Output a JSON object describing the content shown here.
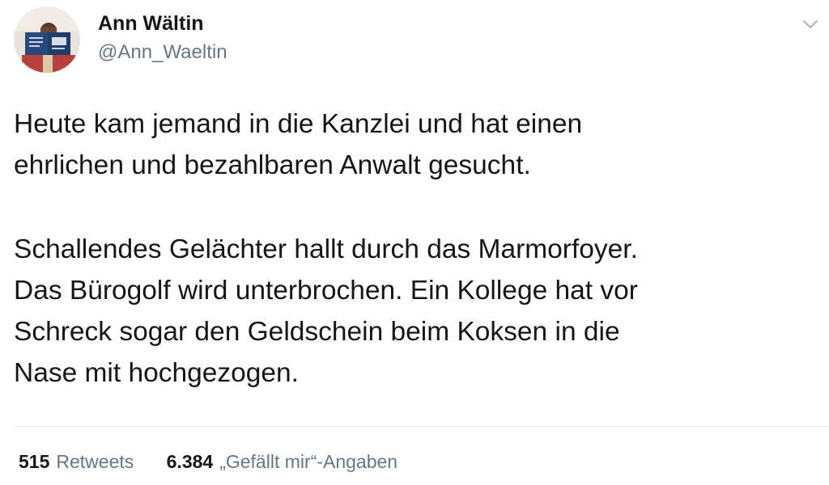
{
  "author": {
    "display_name": "Ann Wältin",
    "handle": "@Ann_Waeltin",
    "avatar_icon": "person-reading-avatar"
  },
  "tweet": {
    "paragraphs": [
      [
        "Heute kam jemand in die Kanzlei und hat einen",
        "ehrlichen und bezahlbaren Anwalt gesucht."
      ],
      [
        "Schallendes Gelächter hallt durch das Marmorfoyer.",
        "Das Bürogolf wird unterbrochen. Ein Kollege hat vor",
        "Schreck sogar den Geldschein beim Koksen in die",
        "Nase mit hochgezogen."
      ]
    ]
  },
  "stats": {
    "retweets": {
      "count": "515",
      "label": "Retweets"
    },
    "likes": {
      "count": "6.384",
      "label": "„Gefällt mir“-Angaben"
    }
  },
  "icons": {
    "menu": "chevron-down-icon"
  },
  "colors": {
    "text": "#14171a",
    "secondary": "#657786",
    "divider": "#e1e8ed",
    "chevron": "#aab8c2"
  }
}
